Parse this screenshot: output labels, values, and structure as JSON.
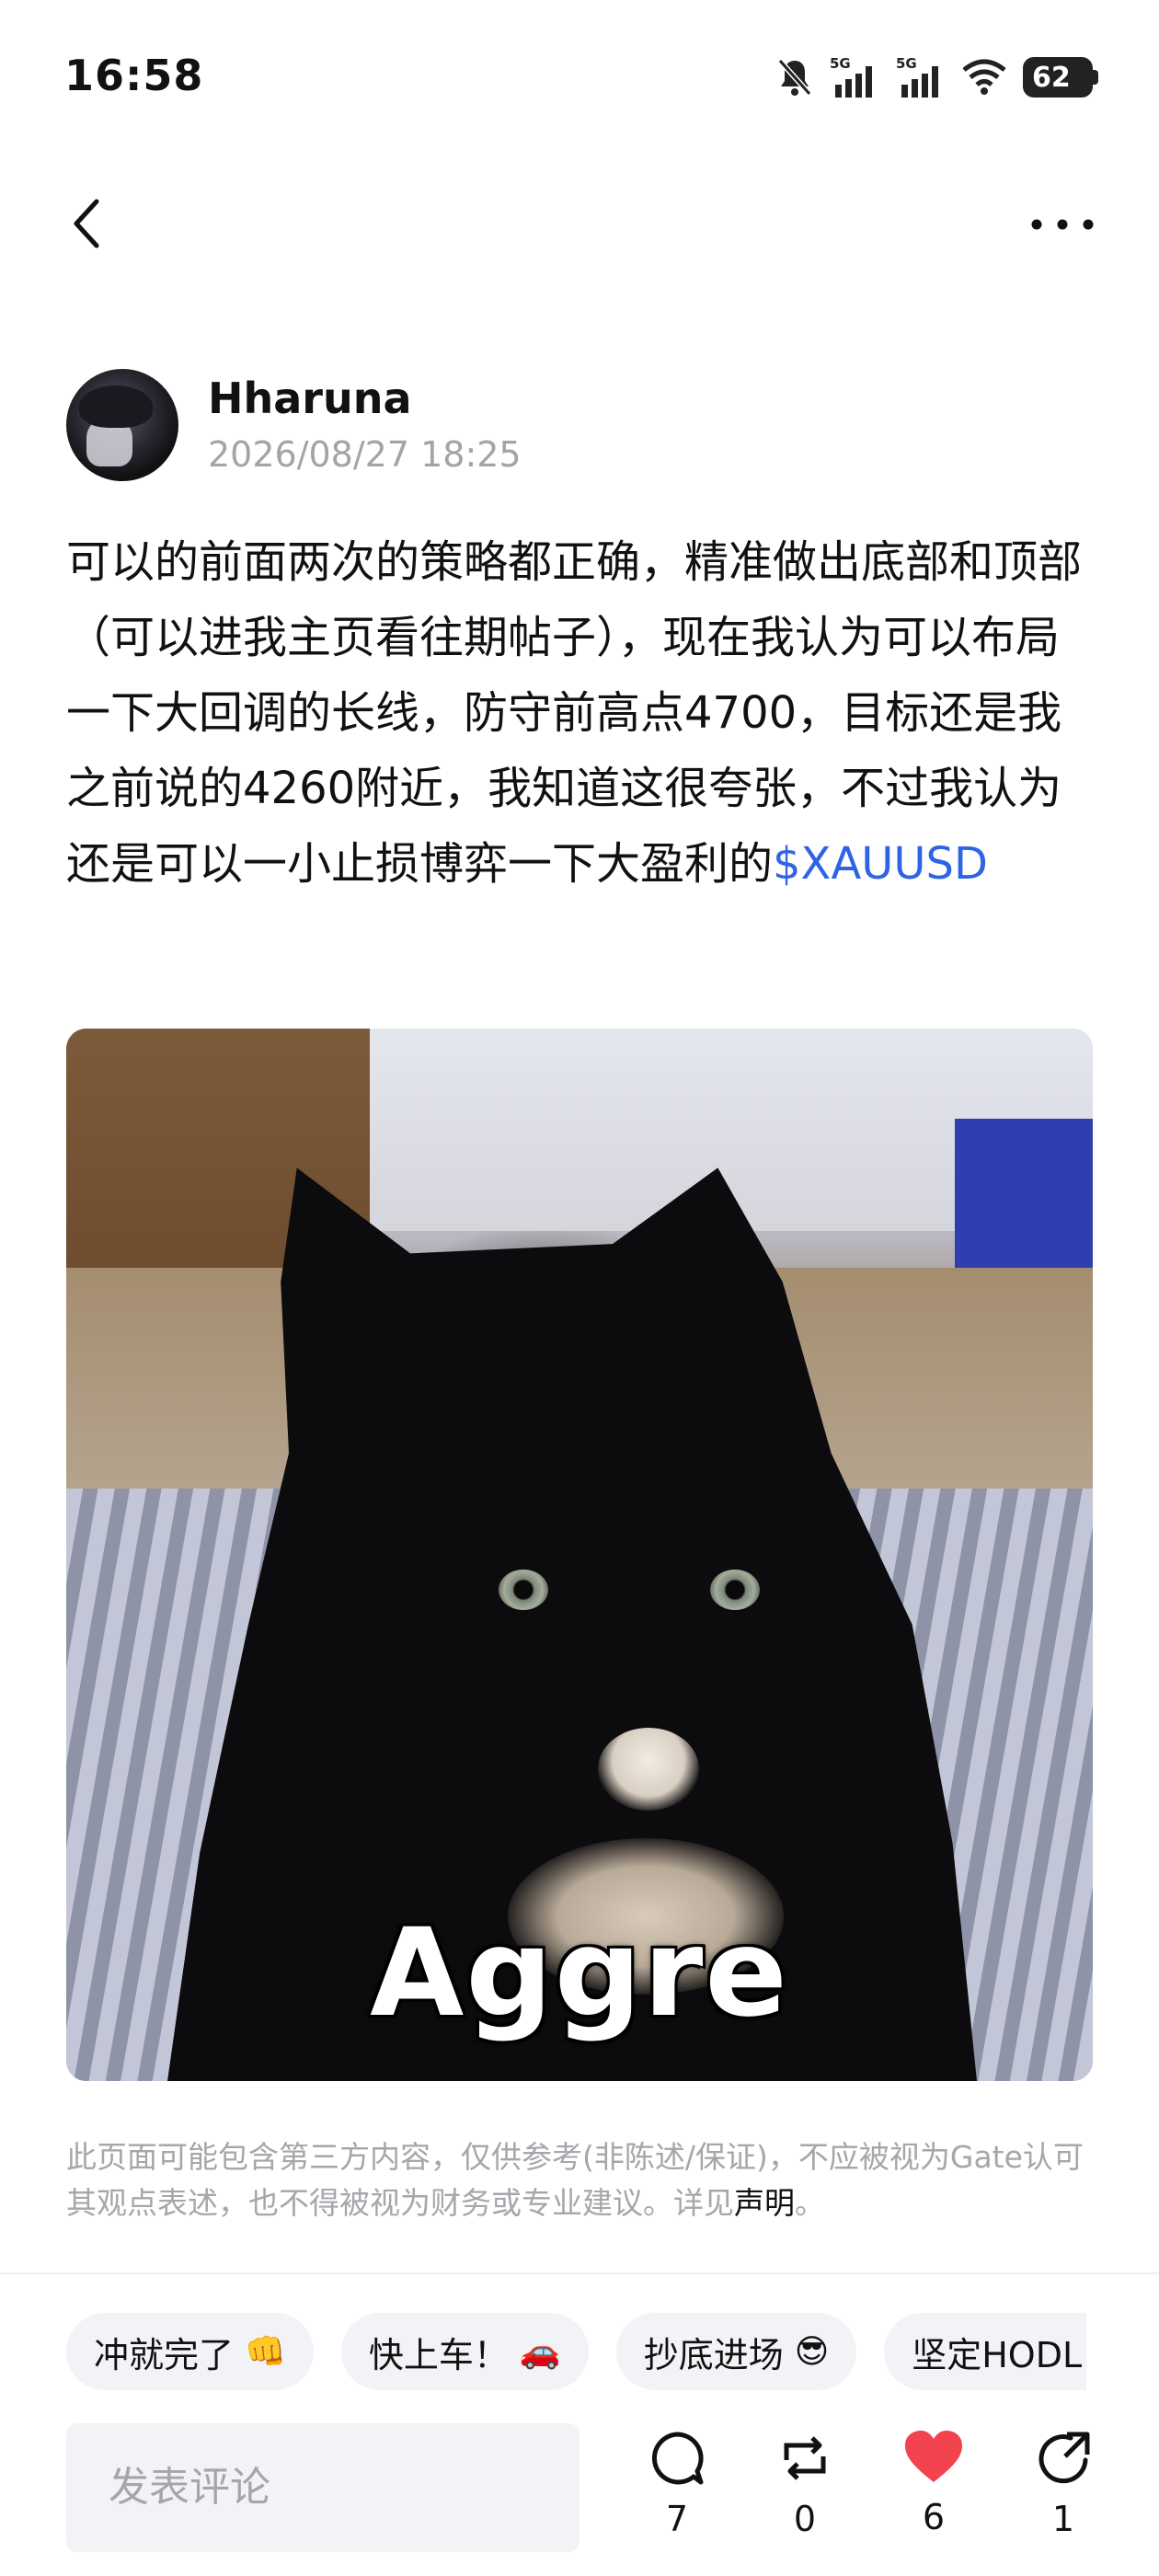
{
  "status_bar": {
    "time": "16:58",
    "battery": "62",
    "network_1": "5G",
    "network_2": "5G"
  },
  "nav": {
    "back_icon": "chevron-left-icon",
    "more_icon": "more-horizontal-icon"
  },
  "post": {
    "author_name": "Hharuna",
    "timestamp": "2026/08/27 18:25",
    "body_text": "可以的前面两次的策略都正确，精准做出底部和顶部（可以进我主页看往期帖子），现在我认为可以布局一下大回调的长线，防守前高点4700，目标还是我之前说的4260附近，我知道这很夸张，不过我认为还是可以一小止损博弈一下大盈利的",
    "ticker": "$XAUUSD",
    "ticker_color": "#2f63e6",
    "image_caption": "Aggre"
  },
  "disclaimer": {
    "text": "此页面可能包含第三方内容，仅供参考(非陈述/保证)，不应被视为Gate认可其观点表述，也不得被视为财务或专业建议。详见",
    "link": "声明",
    "suffix": "。"
  },
  "quick_reactions": [
    {
      "label": "冲就完了",
      "emoji": "👊"
    },
    {
      "label": "快上车！",
      "emoji": "🚗"
    },
    {
      "label": "抄底进场",
      "emoji": "😎"
    },
    {
      "label": "坚定HODL",
      "emoji": "💎"
    }
  ],
  "bottom_bar": {
    "comment_placeholder": "发表评论",
    "comments": "7",
    "reposts": "0",
    "likes": "6",
    "shares": "1",
    "like_color": "#f2434f"
  }
}
